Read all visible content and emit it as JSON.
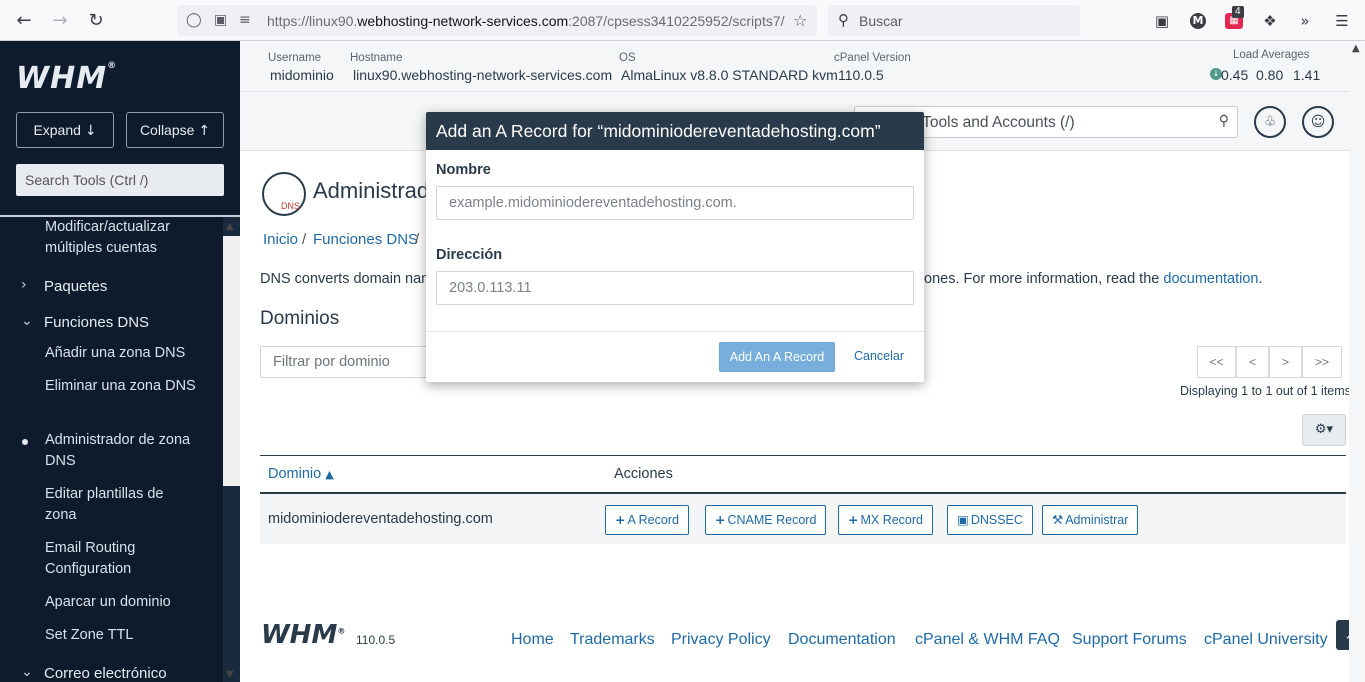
{
  "browser": {
    "url_prefix": "https://linux90.",
    "url_domain": "webhosting-network-services.com",
    "url_suffix": ":2087/cpsess3410225952/scripts7/",
    "search_placeholder": "Buscar",
    "profile_initial": "M",
    "ext_badge": "4"
  },
  "sidebar": {
    "logo": "WHM",
    "expand_label": "Expand",
    "collapse_label": "Collapse",
    "search_placeholder": "Search Tools (Ctrl /)",
    "items": {
      "modify_multi": "Modificar/actualizar múltiples cuentas",
      "packages": "Paquetes",
      "dns_functions": "Funciones DNS",
      "add_zone": "Añadir una zona DNS",
      "delete_zone": "Eliminar una zona DNS",
      "zone_manager": "Administrador de zona DNS",
      "edit_templates": "Editar plantillas de zona",
      "email_routing": "Email Routing Configuration",
      "park_domain": "Aparcar un dominio",
      "set_ttl": "Set Zone TTL",
      "email": "Correo electrónico"
    }
  },
  "infobar": {
    "username_label": "Username",
    "username": "midominio",
    "hostname_label": "Hostname",
    "hostname": "linux90.webhosting-network-services.com",
    "os_label": "OS",
    "os": "AlmaLinux v8.8.0 STANDARD kvm",
    "cpanel_label": "cPanel Version",
    "cpanel": "110.0.5",
    "load_label": "Load Averages",
    "load_1": "0.45",
    "load_2": "0.80",
    "load_3": "1.41"
  },
  "toolbar": {
    "search_text": "Search Tools and Accounts (/)"
  },
  "main": {
    "title": "Administrador de zona DNS",
    "dns_logo_text": "DNS",
    "breadcrumb": {
      "home": "Inicio",
      "dns": "Funciones DNS",
      "sep": "/"
    },
    "desc_start": "DNS converts domain names into computer-readable IP addresses.",
    "desc_end": "ones. For more information, read the",
    "desc_link": "documentation",
    "desc_dot": ".",
    "section": "Dominios",
    "filter_placeholder": "Filtrar por dominio",
    "pager": {
      "first": "<<",
      "prev": "<",
      "next": ">",
      "last": ">>"
    },
    "displaying": "Displaying 1 to 1 out of 1 items",
    "table": {
      "col_domain": "Dominio",
      "col_actions": "Acciones",
      "rows": [
        {
          "domain": "midominiodereventadehosting.com"
        }
      ]
    },
    "actions": {
      "a_record": "A Record",
      "cname_record": "CNAME Record",
      "mx_record": "MX Record",
      "dnssec": "DNSSEC",
      "manage": "Administrar"
    }
  },
  "footer": {
    "logo": "WHM",
    "version": "110.0.5",
    "links": {
      "home": "Home",
      "trademarks": "Trademarks",
      "privacy": "Privacy Policy",
      "docs": "Documentation",
      "faq": "cPanel & WHM FAQ",
      "forums": "Support Forums",
      "university": "cPanel University"
    }
  },
  "modal": {
    "title": "Add an A Record for “midominiodereventadehosting.com”",
    "name_label": "Nombre",
    "name_placeholder": "example.midominiodereventadehosting.com.",
    "address_label": "Dirección",
    "address_placeholder": "203.0.113.11",
    "submit_label": "Add An A Record",
    "cancel_label": "Cancelar"
  },
  "colors": {
    "sidebar_bg": "#0d1b2d",
    "header_dark": "#293a4a",
    "link": "#1f6aa5",
    "primary_disabled": "#78aedb"
  }
}
